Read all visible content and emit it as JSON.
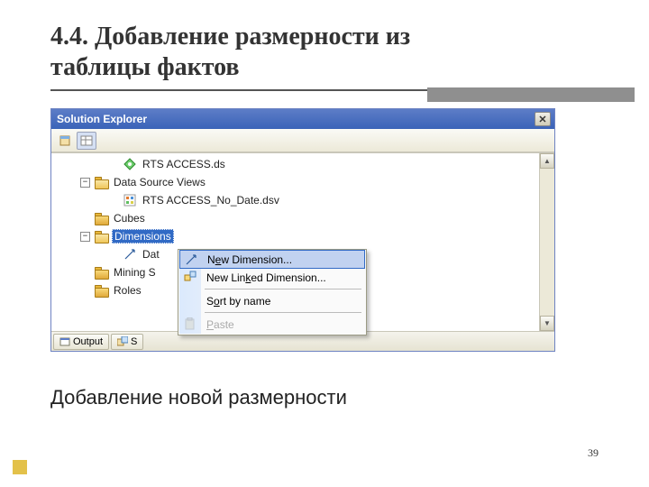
{
  "heading_line1": "4.4. Добавление размерности из",
  "heading_line2": "таблицы фактов",
  "caption": "Добавление новой размерности",
  "page_number": "39",
  "panel": {
    "title": "Solution Explorer",
    "close_glyph": "✕"
  },
  "tree": {
    "rts_ds": "RTS ACCESS.ds",
    "dsv_folder": "Data Source Views",
    "dsv_item": "RTS ACCESS_No_Date.dsv",
    "cubes": "Cubes",
    "dimensions": "Dimensions",
    "date_dim": "Dat",
    "mining": "Mining S",
    "roles": "Roles"
  },
  "bottom": {
    "output": "Output",
    "solution_prefix": "S"
  },
  "context_menu": {
    "new_dimension_pre": "N",
    "new_dimension_u": "e",
    "new_dimension_post": "w Dimension...",
    "new_linked_pre": "New Lin",
    "new_linked_u": "k",
    "new_linked_post": "ed Dimension...",
    "sort_pre": "S",
    "sort_u": "o",
    "sort_post": "rt by name",
    "paste_u": "P",
    "paste_post": "aste"
  }
}
